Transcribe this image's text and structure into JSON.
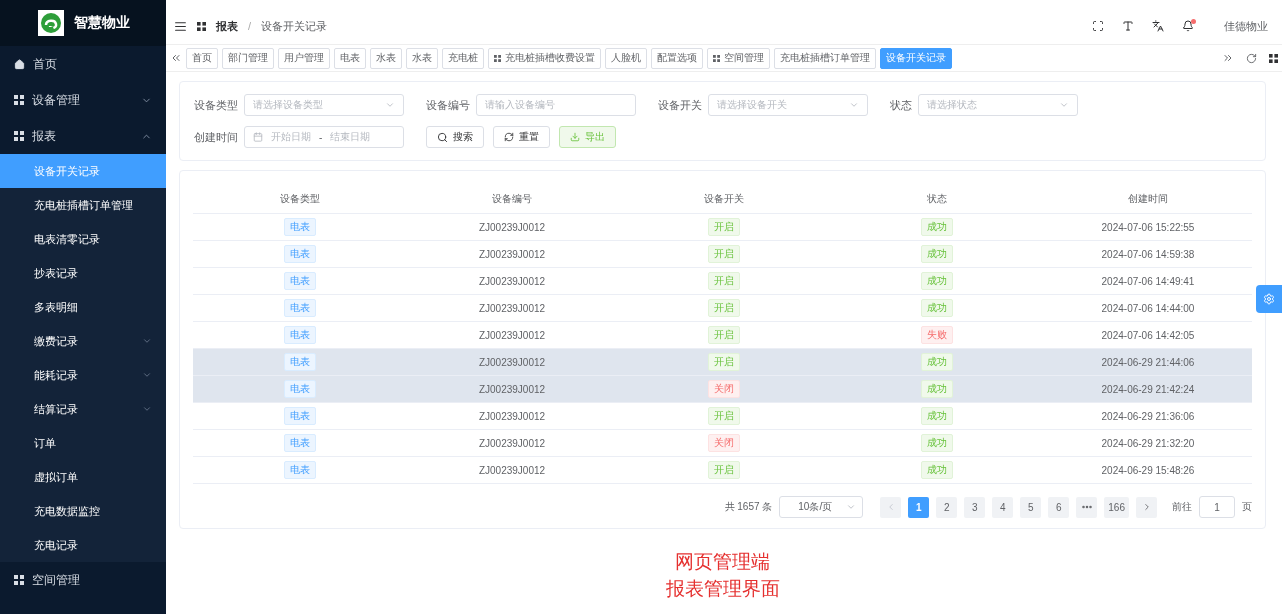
{
  "brand": {
    "name": "智慧物业"
  },
  "sidebar": {
    "items": [
      {
        "kind": "home",
        "label": "首页"
      },
      {
        "kind": "menu",
        "label": "设备管理",
        "expanded": false
      },
      {
        "kind": "menu",
        "label": "报表",
        "expanded": true,
        "children": [
          {
            "kind": "item",
            "label": "设备开关记录",
            "selected": true
          },
          {
            "kind": "item",
            "label": "充电桩插槽订单管理",
            "selected": false
          },
          {
            "kind": "item",
            "label": "电表清零记录",
            "selected": false
          },
          {
            "kind": "item",
            "label": "抄表记录",
            "selected": false
          },
          {
            "kind": "item",
            "label": "多表明细",
            "selected": false
          },
          {
            "kind": "submenu",
            "label": "缴费记录",
            "selected": false,
            "expanded": false
          },
          {
            "kind": "submenu",
            "label": "能耗记录",
            "selected": false,
            "expanded": false
          },
          {
            "kind": "submenu",
            "label": "结算记录",
            "selected": false,
            "expanded": false
          },
          {
            "kind": "item",
            "label": "订单",
            "selected": false
          },
          {
            "kind": "item",
            "label": "虚拟订单",
            "selected": false
          },
          {
            "kind": "item",
            "label": "充电数据监控",
            "selected": false
          },
          {
            "kind": "item",
            "label": "充电记录",
            "selected": false
          }
        ]
      },
      {
        "kind": "menu",
        "label": "空间管理"
      }
    ]
  },
  "breadcrumb": [
    "报表",
    "设备开关记录"
  ],
  "breadcrumb_separator": "/",
  "header_tools": {
    "notifications_unread": true,
    "user": "佳德物业"
  },
  "tabs": [
    {
      "kind": "page",
      "label": "首页",
      "selected": false
    },
    {
      "kind": "page",
      "label": "部门管理",
      "selected": false
    },
    {
      "kind": "page",
      "label": "用户管理",
      "selected": false
    },
    {
      "kind": "page",
      "label": "电表",
      "selected": false
    },
    {
      "kind": "page",
      "label": "水表",
      "selected": false
    },
    {
      "kind": "page",
      "label": "水表",
      "selected": false
    },
    {
      "kind": "page",
      "label": "充电桩",
      "selected": false
    },
    {
      "kind": "menu",
      "label": "充电桩插槽收费设置",
      "selected": false
    },
    {
      "kind": "page",
      "label": "人脸机",
      "selected": false
    },
    {
      "kind": "page",
      "label": "配置选项",
      "selected": false
    },
    {
      "kind": "menu",
      "label": "空间管理",
      "selected": false
    },
    {
      "kind": "page",
      "label": "充电桩插槽订单管理",
      "selected": false
    },
    {
      "kind": "page",
      "label": "设备开关记录",
      "selected": true
    }
  ],
  "filters": [
    {
      "kind": "select",
      "label": "设备类型",
      "placeholder": "请选择设备类型"
    },
    {
      "kind": "input",
      "label": "设备编号",
      "placeholder": "请输入设备编号"
    },
    {
      "kind": "select",
      "label": "设备开关",
      "placeholder": "请选择设备开关"
    },
    {
      "kind": "select",
      "label": "状态",
      "placeholder": "请选择状态"
    }
  ],
  "date_filter": {
    "label": "创建时间",
    "start_placeholder": "开始日期",
    "separator": "-",
    "end_placeholder": "结束日期"
  },
  "actions": [
    {
      "kind": "search",
      "label": "搜索"
    },
    {
      "kind": "reset",
      "label": "重置"
    },
    {
      "kind": "export",
      "label": "导出"
    }
  ],
  "table": {
    "columns": [
      "设备类型",
      "设备编号",
      "设备开关",
      "状态",
      "创建时间"
    ],
    "rows": [
      {
        "selected": false,
        "type": "电表",
        "number": "ZJ00239J0012",
        "switch": {
          "kind": "success",
          "text": "开启"
        },
        "status": {
          "kind": "success",
          "text": "成功"
        },
        "created": "2024-07-06 15:22:55"
      },
      {
        "selected": false,
        "type": "电表",
        "number": "ZJ00239J0012",
        "switch": {
          "kind": "success",
          "text": "开启"
        },
        "status": {
          "kind": "success",
          "text": "成功"
        },
        "created": "2024-07-06 14:59:38"
      },
      {
        "selected": false,
        "type": "电表",
        "number": "ZJ00239J0012",
        "switch": {
          "kind": "success",
          "text": "开启"
        },
        "status": {
          "kind": "success",
          "text": "成功"
        },
        "created": "2024-07-06 14:49:41"
      },
      {
        "selected": false,
        "type": "电表",
        "number": "ZJ00239J0012",
        "switch": {
          "kind": "success",
          "text": "开启"
        },
        "status": {
          "kind": "success",
          "text": "成功"
        },
        "created": "2024-07-06 14:44:00"
      },
      {
        "selected": false,
        "type": "电表",
        "number": "ZJ00239J0012",
        "switch": {
          "kind": "success",
          "text": "开启"
        },
        "status": {
          "kind": "danger",
          "text": "失败"
        },
        "created": "2024-07-06 14:42:05"
      },
      {
        "selected": true,
        "type": "电表",
        "number": "ZJ00239J0012",
        "switch": {
          "kind": "success",
          "text": "开启"
        },
        "status": {
          "kind": "success",
          "text": "成功"
        },
        "created": "2024-06-29 21:44:06"
      },
      {
        "selected": true,
        "type": "电表",
        "number": "ZJ00239J0012",
        "switch": {
          "kind": "danger",
          "text": "关闭"
        },
        "status": {
          "kind": "success",
          "text": "成功"
        },
        "created": "2024-06-29 21:42:24"
      },
      {
        "selected": false,
        "type": "电表",
        "number": "ZJ00239J0012",
        "switch": {
          "kind": "success",
          "text": "开启"
        },
        "status": {
          "kind": "success",
          "text": "成功"
        },
        "created": "2024-06-29 21:36:06"
      },
      {
        "selected": false,
        "type": "电表",
        "number": "ZJ00239J0012",
        "switch": {
          "kind": "danger",
          "text": "关闭"
        },
        "status": {
          "kind": "success",
          "text": "成功"
        },
        "created": "2024-06-29 21:32:20"
      },
      {
        "selected": false,
        "type": "电表",
        "number": "ZJ00239J0012",
        "switch": {
          "kind": "success",
          "text": "开启"
        },
        "status": {
          "kind": "success",
          "text": "成功"
        },
        "created": "2024-06-29 15:48:26"
      }
    ]
  },
  "pagination": {
    "total": "共 1657 条",
    "page_size": "10条/页",
    "pages": [
      {
        "kind": "page",
        "label": "1",
        "selected": true
      },
      {
        "kind": "page",
        "label": "2",
        "selected": false
      },
      {
        "kind": "page",
        "label": "3",
        "selected": false
      },
      {
        "kind": "page",
        "label": "4",
        "selected": false
      },
      {
        "kind": "page",
        "label": "5",
        "selected": false
      },
      {
        "kind": "page",
        "label": "6",
        "selected": false
      },
      {
        "kind": "more",
        "selected": false
      },
      {
        "kind": "page",
        "label": "166",
        "selected": false
      }
    ],
    "jump_label": "前往",
    "jump_value": "1",
    "jump_suffix": "页"
  },
  "caption": [
    "网页管理端",
    "报表管理界面"
  ]
}
